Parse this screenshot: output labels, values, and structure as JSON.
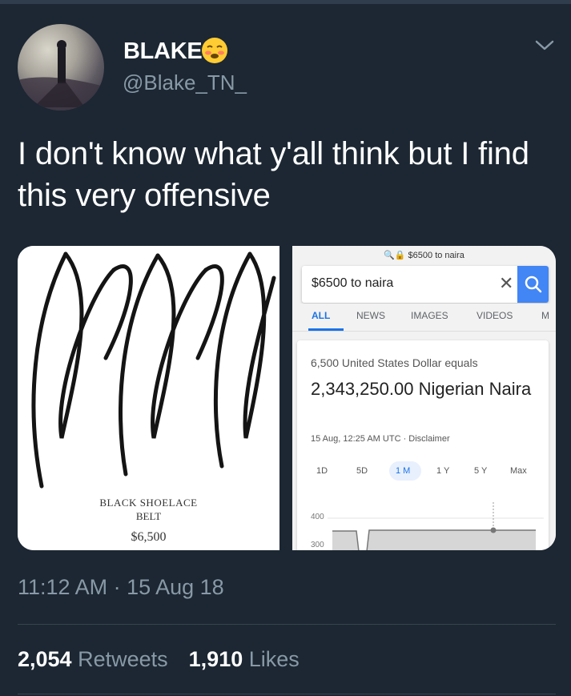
{
  "user": {
    "display_name": "BLAKE",
    "handle": "@Blake_TN_",
    "emoji_icon": "worried-face-emoji"
  },
  "tweet": {
    "text": "I don't know what y'all think but I find this very offensive",
    "timestamp": "11:12 AM · 15 Aug 18"
  },
  "image_left": {
    "caption_line1": "BLACK SHOELACE",
    "caption_line2": "BELT",
    "price": "$6,500"
  },
  "image_right": {
    "url_bar": "$6500 to naira",
    "search_query": "$6500 to naira",
    "tabs": [
      "ALL",
      "NEWS",
      "IMAGES",
      "VIDEOS",
      "M"
    ],
    "active_tab": "ALL",
    "equals_text": "6,500 United States Dollar equals",
    "result_text": "2,343,250.00 Nigerian Naira",
    "timestamp_text": "15 Aug, 12:25 AM UTC · Disclaimer",
    "ranges": [
      "1D",
      "5D",
      "1 M",
      "1 Y",
      "5 Y",
      "Max"
    ],
    "active_range": "1 M",
    "y_labels": [
      "400",
      "300"
    ]
  },
  "stats": {
    "retweets_count": "2,054",
    "retweets_label": "Retweets",
    "likes_count": "1,910",
    "likes_label": "Likes"
  },
  "colors": {
    "background": "#1c2733",
    "secondary_text": "#8899a6",
    "google_blue": "#4285f4"
  }
}
